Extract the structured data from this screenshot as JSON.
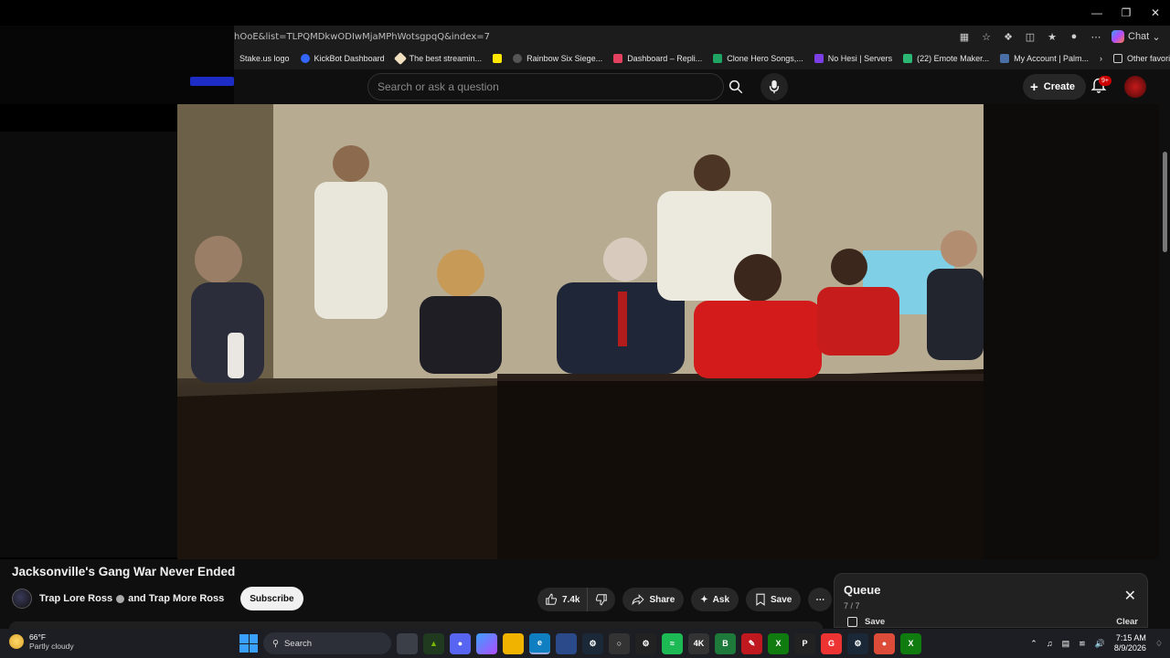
{
  "browser": {
    "url": "hOoE&list=TLPQMDkwODIwMjaMPhWotsgpqQ&index=7",
    "chat_label": "Chat",
    "bookmarks": [
      "Stake.us logo",
      "KickBot Dashboard",
      "The best streamin...",
      "Rainbow Six Siege...",
      "Dashboard – Repli...",
      "Clone Hero Songs,...",
      "No Hesi | Servers",
      "(22) Emote Maker...",
      "My Account | Palm..."
    ],
    "other_favorites": "Other favorites"
  },
  "youtube": {
    "search_placeholder": "Search or ask a question",
    "create_label": "Create",
    "notif_count": "9+"
  },
  "video": {
    "title": "Jacksonville's Gang War Never Ended",
    "channel": "Trap Lore Ross",
    "collab": "and Trap More Ross",
    "subscribe": "Subscribe",
    "likes": "7.4k",
    "share": "Share",
    "ask": "Ask",
    "save": "Save"
  },
  "queue": {
    "title": "Queue",
    "count": "7 / 7",
    "save": "Save",
    "clear": "Clear"
  },
  "taskbar": {
    "temp": "66°F",
    "condition": "Partly cloudy",
    "search": "Search",
    "time": "7:15 AM",
    "date": "8/9/2026"
  }
}
